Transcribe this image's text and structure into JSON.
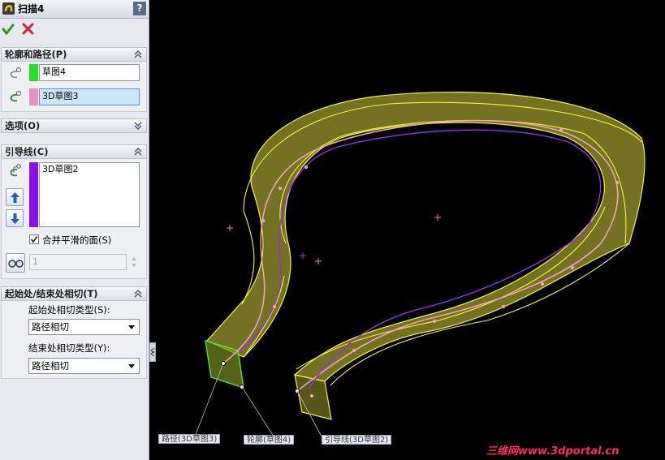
{
  "title": "扫描4",
  "help_label": "?",
  "sections": {
    "profile_path": {
      "header": "轮廓和路径(P)",
      "profile_value": "草图4",
      "path_value": "3D草图3"
    },
    "options": {
      "header": "选项(O)"
    },
    "guides": {
      "header": "引导线(C)",
      "list": [
        "3D草图2"
      ],
      "merge_label": "合并平滑的面(S)",
      "merge_checked": true,
      "spin_value": "1"
    },
    "tangency": {
      "header": "起始处/结束处相切(T)",
      "start_label": "起始处相切类型(S):",
      "start_value": "路径相切",
      "end_label": "结束处相切类型(Y):",
      "end_value": "路径相切"
    }
  },
  "viewport": {
    "labels": {
      "path": "路径(3D草图3)",
      "profile": "轮廓(草图4)",
      "guide": "引导线(3D草图2)"
    },
    "watermark": "三维网www.3dportal.cn"
  },
  "colors": {
    "profile_swatch": "#22e022",
    "path_swatch": "#e890c0",
    "guide_swatch": "#8a10e8",
    "sweep_fill": "#9a9a30",
    "sweep_edge": "#f4f43c",
    "watermark": "#ff2a5f"
  },
  "icons": [
    "sweep-icon",
    "help-icon",
    "ok-icon",
    "cancel-icon",
    "profile-icon",
    "path-icon",
    "guide-curve-icon",
    "move-up-icon",
    "move-down-icon",
    "show-sections-icon",
    "chevron-up-icon",
    "chevron-down-icon",
    "dropdown-icon"
  ]
}
